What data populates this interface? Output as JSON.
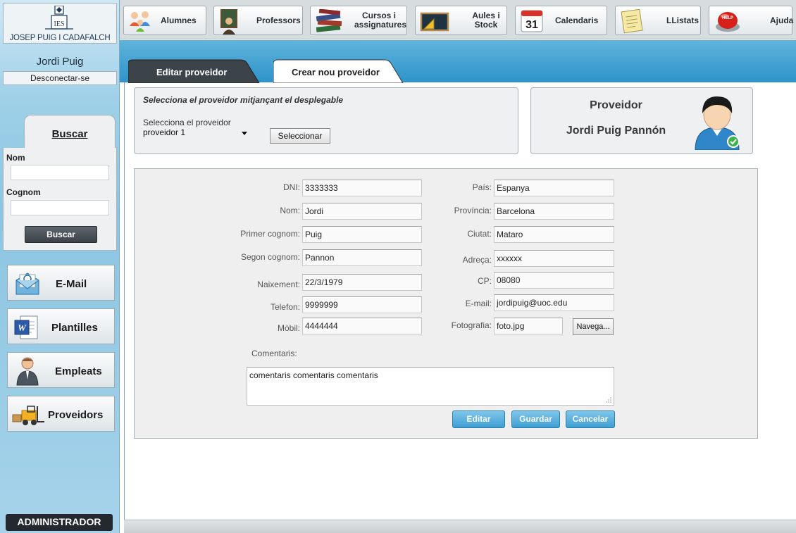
{
  "school": {
    "logo_text": "JOSEP PUIG I CADAFALCH",
    "logo_mark_text": "IES"
  },
  "user": {
    "name": "Jordi Puig",
    "disconnect_label": "Desconectar-se"
  },
  "search": {
    "tab_label": "Buscar",
    "name_label": "Nom",
    "surname_label": "Cognom",
    "name_value": "",
    "surname_value": "",
    "button_label": "Buscar"
  },
  "side_nav": [
    {
      "label": "E-Mail",
      "icon": "email-icon"
    },
    {
      "label": "Plantilles",
      "icon": "word-document-icon"
    },
    {
      "label": "Empleats",
      "icon": "employee-icon"
    },
    {
      "label": "Proveidors",
      "icon": "forklift-icon"
    }
  ],
  "role_badge": "ADMINISTRADOR",
  "top_nav": [
    {
      "label": "Alumnes",
      "icon": "students-icon"
    },
    {
      "label": "Professors",
      "icon": "teacher-icon"
    },
    {
      "label": "Cursos i assignatures",
      "icon": "books-icon"
    },
    {
      "label": "Aules i Stock",
      "icon": "blackboard-icon"
    },
    {
      "label": "Calendaris",
      "icon": "calendar-icon",
      "icon_text": "31"
    },
    {
      "label": "LListats",
      "icon": "list-icon"
    },
    {
      "label": "Ajuda",
      "icon": "help-button-icon",
      "icon_text": "HELP"
    }
  ],
  "tabs": {
    "active": "Editar proveidor",
    "inactive": "Crear nou proveidor"
  },
  "selector": {
    "title": "Selecciona el proveidor mitjançant el desplegable",
    "label": "Selecciona el proveidor",
    "selected": "proveidor 1",
    "button_label": "Seleccionar"
  },
  "provider_card": {
    "heading": "Proveidor",
    "name": "Jordi Puig Pannón"
  },
  "form": {
    "left": [
      {
        "label": "DNI:",
        "value": "3333333"
      },
      {
        "label": "Nom:",
        "value": "Jordi"
      },
      {
        "label": "Primer cognom:",
        "value": "Puig"
      },
      {
        "label": "Segon cognom:",
        "value": "Pannon"
      },
      {
        "label": "Naixement:",
        "value": "22/3/1979"
      },
      {
        "label": "Telefon:",
        "value": "9999999"
      },
      {
        "label": "Mòbil:",
        "value": "4444444"
      }
    ],
    "right": [
      {
        "label": "País:",
        "value": "Espanya"
      },
      {
        "label": "Província:",
        "value": "Barcelona"
      },
      {
        "label": "Ciutat:",
        "value": "Mataro"
      },
      {
        "label": "Adreça:",
        "value": "xxxxxx"
      },
      {
        "label": "CP:",
        "value": "08080"
      },
      {
        "label": "E-mail:",
        "value": "jordipuig@uoc.edu"
      },
      {
        "label": "Fotografia:",
        "value": "foto.jpg"
      }
    ],
    "browse_label": "Navega...",
    "comments_label": "Comentaris:",
    "comments_value": "comentaris comentaris comentaris"
  },
  "actions": {
    "edit": "Editar",
    "save": "Guardar",
    "cancel": "Cancelar"
  },
  "colors": {
    "accent_blue": "#3e9ed2",
    "band_blue": "#2f93c9",
    "sidebar_blue": "#8cc5e2",
    "dark_button": "#3b4248"
  }
}
